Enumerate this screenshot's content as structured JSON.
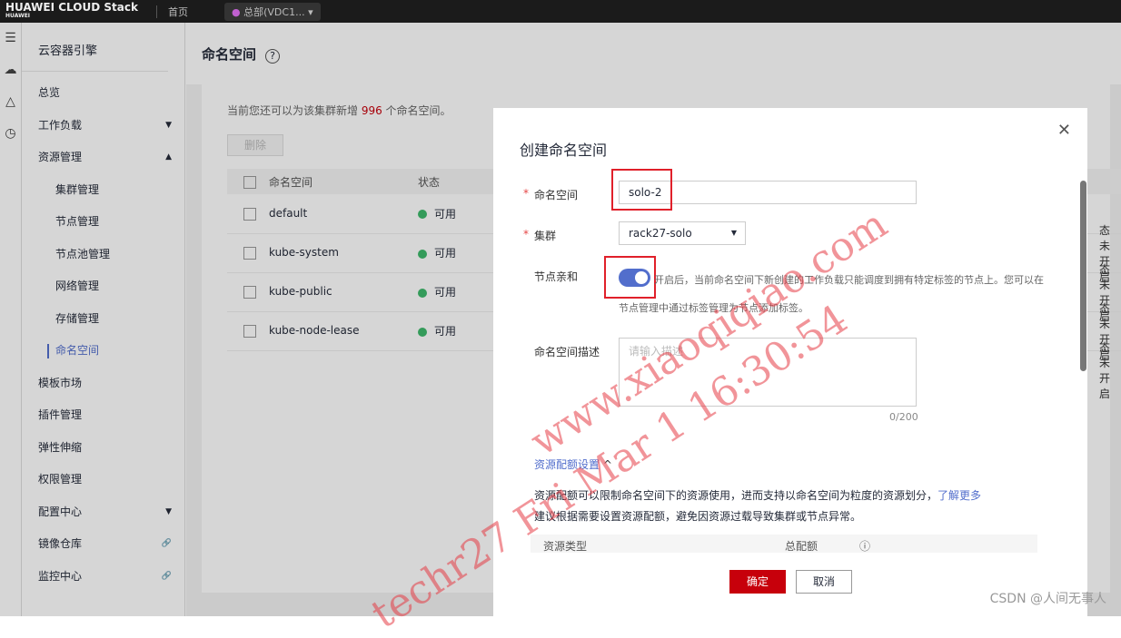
{
  "topbar": {
    "logo": "HUAWEI CLOUD Stack",
    "logo_sub": "HUAWEI",
    "home": "首页",
    "region": "总部(VDC1..."
  },
  "sidebar": {
    "title": "云容器引擎",
    "items": [
      {
        "label": "总览"
      },
      {
        "label": "工作负载",
        "arrow": "▼"
      },
      {
        "label": "资源管理",
        "arrow": "▲"
      },
      {
        "label": "集群管理",
        "sub": true
      },
      {
        "label": "节点管理",
        "sub": true
      },
      {
        "label": "节点池管理",
        "sub": true
      },
      {
        "label": "网络管理",
        "sub": true
      },
      {
        "label": "存储管理",
        "sub": true
      },
      {
        "label": "命名空间",
        "sub": true,
        "active": true
      },
      {
        "label": "模板市场"
      },
      {
        "label": "插件管理"
      },
      {
        "label": "弹性伸缩"
      },
      {
        "label": "权限管理"
      },
      {
        "label": "配置中心",
        "arrow": "▼"
      },
      {
        "label": "镜像仓库",
        "arrow": "🔗"
      },
      {
        "label": "监控中心",
        "arrow": "🔗"
      }
    ]
  },
  "main": {
    "title": "命名空间",
    "hint_pre": "当前您还可以为该集群新增 ",
    "hint_count": "996",
    "hint_post": " 个命名空间。",
    "delete": "删除",
    "columns": [
      "命名空间",
      "状态"
    ],
    "rows": [
      {
        "name": "default",
        "status": "可用",
        "right": "态未开启"
      },
      {
        "name": "kube-system",
        "status": "可用",
        "right": "态未开启"
      },
      {
        "name": "kube-public",
        "status": "可用",
        "right": "态未开启"
      },
      {
        "name": "kube-node-lease",
        "status": "可用",
        "right": "态未开启"
      }
    ]
  },
  "modal": {
    "title": "创建命名空间",
    "name_label": "命名空间",
    "name_value": "solo-2",
    "cluster_label": "集群",
    "cluster_value": "rack27-solo",
    "affinity_label": "节点亲和",
    "affinity_enabled": true,
    "affinity_text1": "开启后，当前命名空间下新创建的工作负载只能调度到拥有特定标签的节点上。您可以在",
    "affinity_text2": "节点管理中通过标签管理为节点添加标签。",
    "desc_label": "命名空间描述",
    "desc_placeholder": "请输入描述",
    "desc_count": "0/200",
    "quota_toggle": "资源配额设置",
    "quota_text1": "资源配额可以限制命名空间下的资源使用，进而支持以命名空间为粒度的资源划分，",
    "learn_more": "了解更多",
    "quota_text2": "建议根据需要设置资源配额，避免因资源过载导致集群或节点异常。",
    "quota_col1": "资源类型",
    "quota_col2": "总配额",
    "ok": "确定",
    "cancel": "取消"
  },
  "watermark": {
    "line1": "www.xiaoqiqiao.com",
    "line2": "techr27 Fri Mar 1 16:30:54"
  },
  "footer": {
    "csdn": "CSDN @人间无事人"
  },
  "colors": {
    "accent": "#526ecc",
    "primary_button": "#c7000b",
    "highlight_box": "#e0202a"
  }
}
